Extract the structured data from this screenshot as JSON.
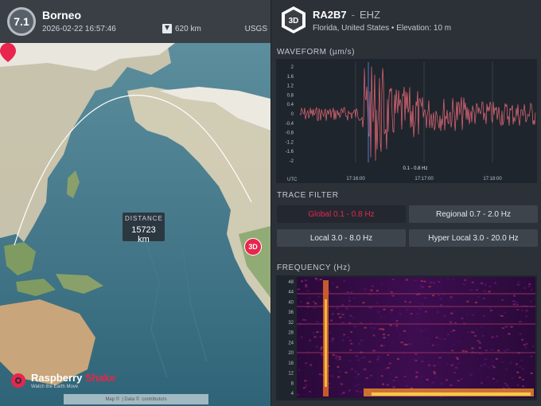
{
  "earthquake": {
    "magnitude": "7.1",
    "region": "Borneo",
    "datetime": "2026-02-22 16:57:46",
    "depth": "620 km",
    "source": "USGS"
  },
  "map": {
    "distance_label": "DISTANCE",
    "distance_value": "15723 km",
    "station_marker": "3D",
    "attribution_map": "Map ©",
    "attribution_data": "| Data ©",
    "attribution_contrib": "contributors"
  },
  "brand": {
    "name_part1": "Raspberry",
    "name_part2": "Shake",
    "tagline": "Watch the Earth Move"
  },
  "station": {
    "icon_label": "3D",
    "code": "RA2B7",
    "separator": "-",
    "channel": "EHZ",
    "location": "Florida, United States • Elevation: 10 m"
  },
  "waveform": {
    "title": "WAVEFORM (µm/s)",
    "y_ticks": [
      "2",
      "1.6",
      "1.2",
      "0.8",
      "0.4",
      "0",
      "-0.4",
      "-0.8",
      "-1.2",
      "-1.6",
      "-2"
    ],
    "x_ticks": [
      "17:16:00",
      "17:17:00",
      "17:18:00"
    ],
    "utc_label": "UTC",
    "filter_badge": "0.1 - 0.8 Hz",
    "trace_color": "#e86a7a"
  },
  "trace_filter": {
    "title": "TRACE FILTER",
    "options": [
      {
        "label": "Global 0.1 - 0.8 Hz",
        "active": true
      },
      {
        "label": "Regional 0.7 - 2.0 Hz",
        "active": false
      },
      {
        "label": "Local 3.0 - 8.0 Hz",
        "active": false
      },
      {
        "label": "Hyper Local 3.0 - 20.0 Hz",
        "active": false
      }
    ],
    "accent": "#e8254d"
  },
  "frequency": {
    "title": "FREQUENCY (Hz)",
    "y_ticks": [
      "48",
      "44",
      "40",
      "36",
      "32",
      "28",
      "24",
      "20",
      "16",
      "12",
      "8",
      "4"
    ]
  }
}
